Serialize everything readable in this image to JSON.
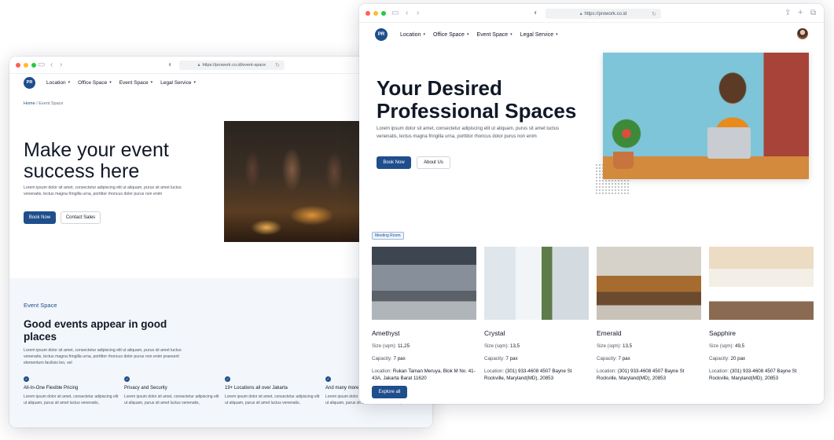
{
  "back": {
    "url": "https://prowork.co.id/event-space",
    "logo": "PR",
    "nav": [
      {
        "label": "Location"
      },
      {
        "label": "Office Space"
      },
      {
        "label": "Event Space"
      },
      {
        "label": "Legal Service"
      }
    ],
    "breadcrumb": {
      "home": "Home",
      "sep": "/",
      "current": "Event Space"
    },
    "hero": {
      "title": "Make your event success here",
      "description": "Lorem ipsum dolor sit amet, consectetur adipiscing elit ut aliquam, purus sit amet luctus venenatis, lectus magna fringilla urna, porttitor rhoncus dolor purus non enim",
      "primary_button": "Book Now",
      "secondary_button": "Contact Sales"
    },
    "section": {
      "label": "Event Space",
      "title": "Good events appear in good places",
      "description": "Lorem ipsum dolor sit amet, consectetur adipiscing elit ut aliquam, purus sit amet luctus venenatis, lectus magna fringilla urna, porttitor rhoncus dolor purus non enim praesent elementum facilisis leo, vel"
    },
    "features": [
      {
        "title": "All-In-One Flexible Pricing",
        "description": "Lorem ipsum dolor sit amet, consectetur adipiscing elit ut aliquam, purus sit amet luctus venenatis,"
      },
      {
        "title": "Privacy and Security",
        "description": "Lorem ipsum dolor sit amet, consectetur adipiscing elit ut aliquam, purus sit amet luctus venenatis,"
      },
      {
        "title": "19+ Locations all over Jakarta",
        "description": "Lorem ipsum dolor sit amet, consectetur adipiscing elit ut aliquam, purus sit amet luctus venenatis,"
      },
      {
        "title": "And many more",
        "description": "Lorem ipsum dolor sit amet, consectetur adipiscing elit ut aliquam, purus sit amet luctus venenatis,"
      }
    ]
  },
  "front": {
    "url": "https://prowork.co.id",
    "logo": "PR",
    "nav": [
      {
        "label": "Location"
      },
      {
        "label": "Office Space"
      },
      {
        "label": "Event Space"
      },
      {
        "label": "Legal Service"
      }
    ],
    "hero": {
      "title": "Your Desired Professional Spaces",
      "description": "Lorem ipsum dolor sit amet, consectetur adipiscing elit ut aliquam, purus sit amet luctus venenatis, lectus magna fringilla urna, porttitor rhoncus dolor purus non enim",
      "primary_button": "Book Now",
      "secondary_button": "About Us"
    },
    "badge": "Meeting Room",
    "labels": {
      "size": "Size (sqm):",
      "capacity": "Capacity:",
      "location": "Location:"
    },
    "rooms": [
      {
        "name": "Amethyst",
        "size": "11,25",
        "capacity": "7 pax",
        "location": "Rukan Taman Meruya, Blok M No. 41-43A, Jakarta Barat 11620"
      },
      {
        "name": "Crystal",
        "size": "13,5",
        "capacity": "7 pax",
        "location": "(301) 933-4608 4507 Bayne St Rockville, Maryland(MD), 20853"
      },
      {
        "name": "Emerald",
        "size": "13,5",
        "capacity": "7 pax",
        "location": "(301) 933-4608 4507 Bayne St Rockville, Maryland(MD), 20853"
      },
      {
        "name": "Sapphire",
        "size": "49,5",
        "capacity": "20 pax",
        "location": "(301) 933-4608 4507 Bayne St Rockville, Maryland(MD), 20853"
      }
    ],
    "explore_button": "Explore all"
  },
  "icons": {
    "check": "check-circle-icon",
    "chevron": "chevron-down-icon",
    "lock": "lock-icon",
    "reload": "reload-icon",
    "share": "share-icon",
    "new_tab": "plus-icon",
    "tabs": "tabs-icon"
  },
  "colors": {
    "brand": "#1f4e8c",
    "section_bg": "#f3f6fa"
  }
}
